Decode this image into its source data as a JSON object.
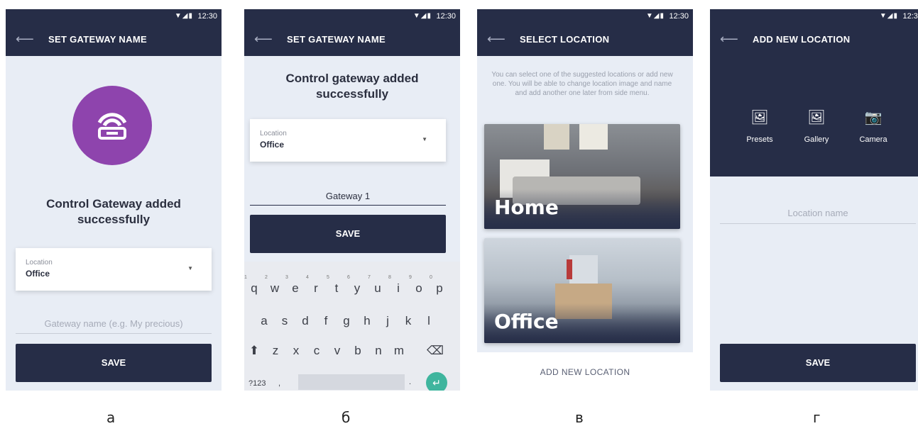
{
  "status": {
    "signal": "▼◢▮",
    "time": "12:30"
  },
  "screens": [
    {
      "title": "SET GATEWAY NAME",
      "heading": [
        "Control Gateway added",
        "successfully"
      ],
      "location": {
        "label": "Location",
        "value": "Office"
      },
      "name_placeholder": "Gateway name (e.g. My precious)",
      "save": "SAVE",
      "caption": "а"
    },
    {
      "title": "SET GATEWAY NAME",
      "heading": [
        "Control gateway added",
        "successfully"
      ],
      "location": {
        "label": "Location",
        "value": "Office"
      },
      "name_value": "Gateway 1",
      "save": "SAVE",
      "keyboard": {
        "row1": [
          "q",
          "w",
          "e",
          "r",
          "t",
          "y",
          "u",
          "i",
          "o",
          "p"
        ],
        "row1_hints": [
          "1",
          "2",
          "3",
          "4",
          "5",
          "6",
          "7",
          "8",
          "9",
          "0"
        ],
        "row2": [
          "a",
          "s",
          "d",
          "f",
          "g",
          "h",
          "j",
          "k",
          "l"
        ],
        "row3": [
          "z",
          "x",
          "c",
          "v",
          "b",
          "n",
          "m"
        ],
        "symbols": "?123",
        "comma": ",",
        "period": "."
      },
      "caption": "б"
    },
    {
      "title": "SELECT LOCATION",
      "intro": "You can select one of the suggested locations or add new one. You will be able to change location image and name and add another one later from side menu.",
      "locations": [
        "Home",
        "Office"
      ],
      "add_new": "ADD NEW LOCATION",
      "caption": "в"
    },
    {
      "title": "ADD NEW LOCATION",
      "media": [
        "Presets",
        "Gallery",
        "Camera"
      ],
      "name_placeholder": "Location name",
      "save": "SAVE",
      "caption": "г"
    }
  ],
  "colors": {
    "primary": "#262d47",
    "accent": "#8e44ad",
    "background": "#e8edf5",
    "enter_key": "#3fb59e"
  }
}
